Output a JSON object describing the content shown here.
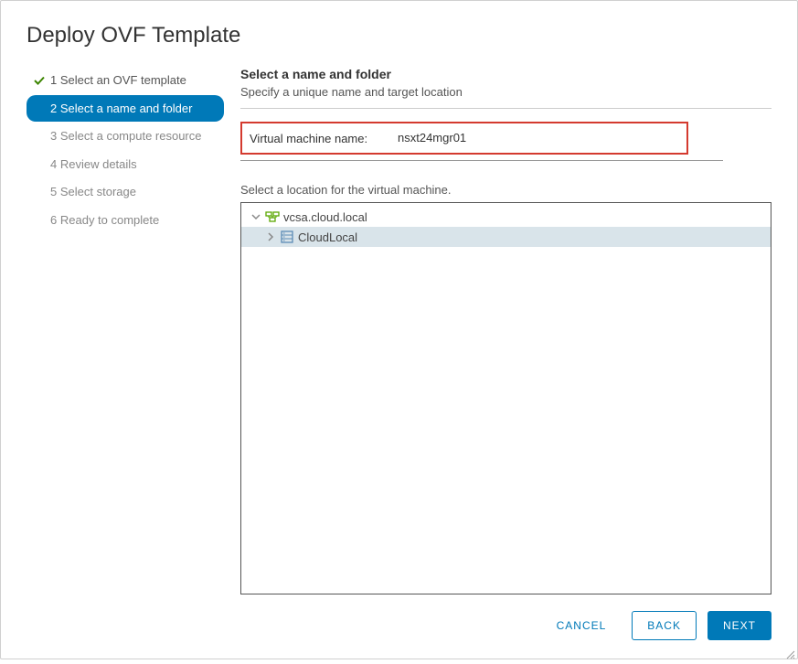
{
  "dialog": {
    "title": "Deploy OVF Template"
  },
  "steps": [
    {
      "num": "1",
      "label": "Select an OVF template",
      "state": "completed"
    },
    {
      "num": "2",
      "label": "Select a name and folder",
      "state": "active"
    },
    {
      "num": "3",
      "label": "Select a compute resource",
      "state": "pending"
    },
    {
      "num": "4",
      "label": "Review details",
      "state": "pending"
    },
    {
      "num": "5",
      "label": "Select storage",
      "state": "pending"
    },
    {
      "num": "6",
      "label": "Ready to complete",
      "state": "pending"
    }
  ],
  "content": {
    "section_title": "Select a name and folder",
    "section_subtitle": "Specify a unique name and target location",
    "vm_name_label": "Virtual machine name:",
    "vm_name_value": "nsxt24mgr01",
    "location_label": "Select a location for the virtual machine."
  },
  "tree": {
    "root": {
      "label": "vcsa.cloud.local",
      "expanded": true
    },
    "child": {
      "label": "CloudLocal",
      "expanded": false,
      "selected": true
    }
  },
  "footer": {
    "cancel": "CANCEL",
    "back": "BACK",
    "next": "NEXT"
  }
}
